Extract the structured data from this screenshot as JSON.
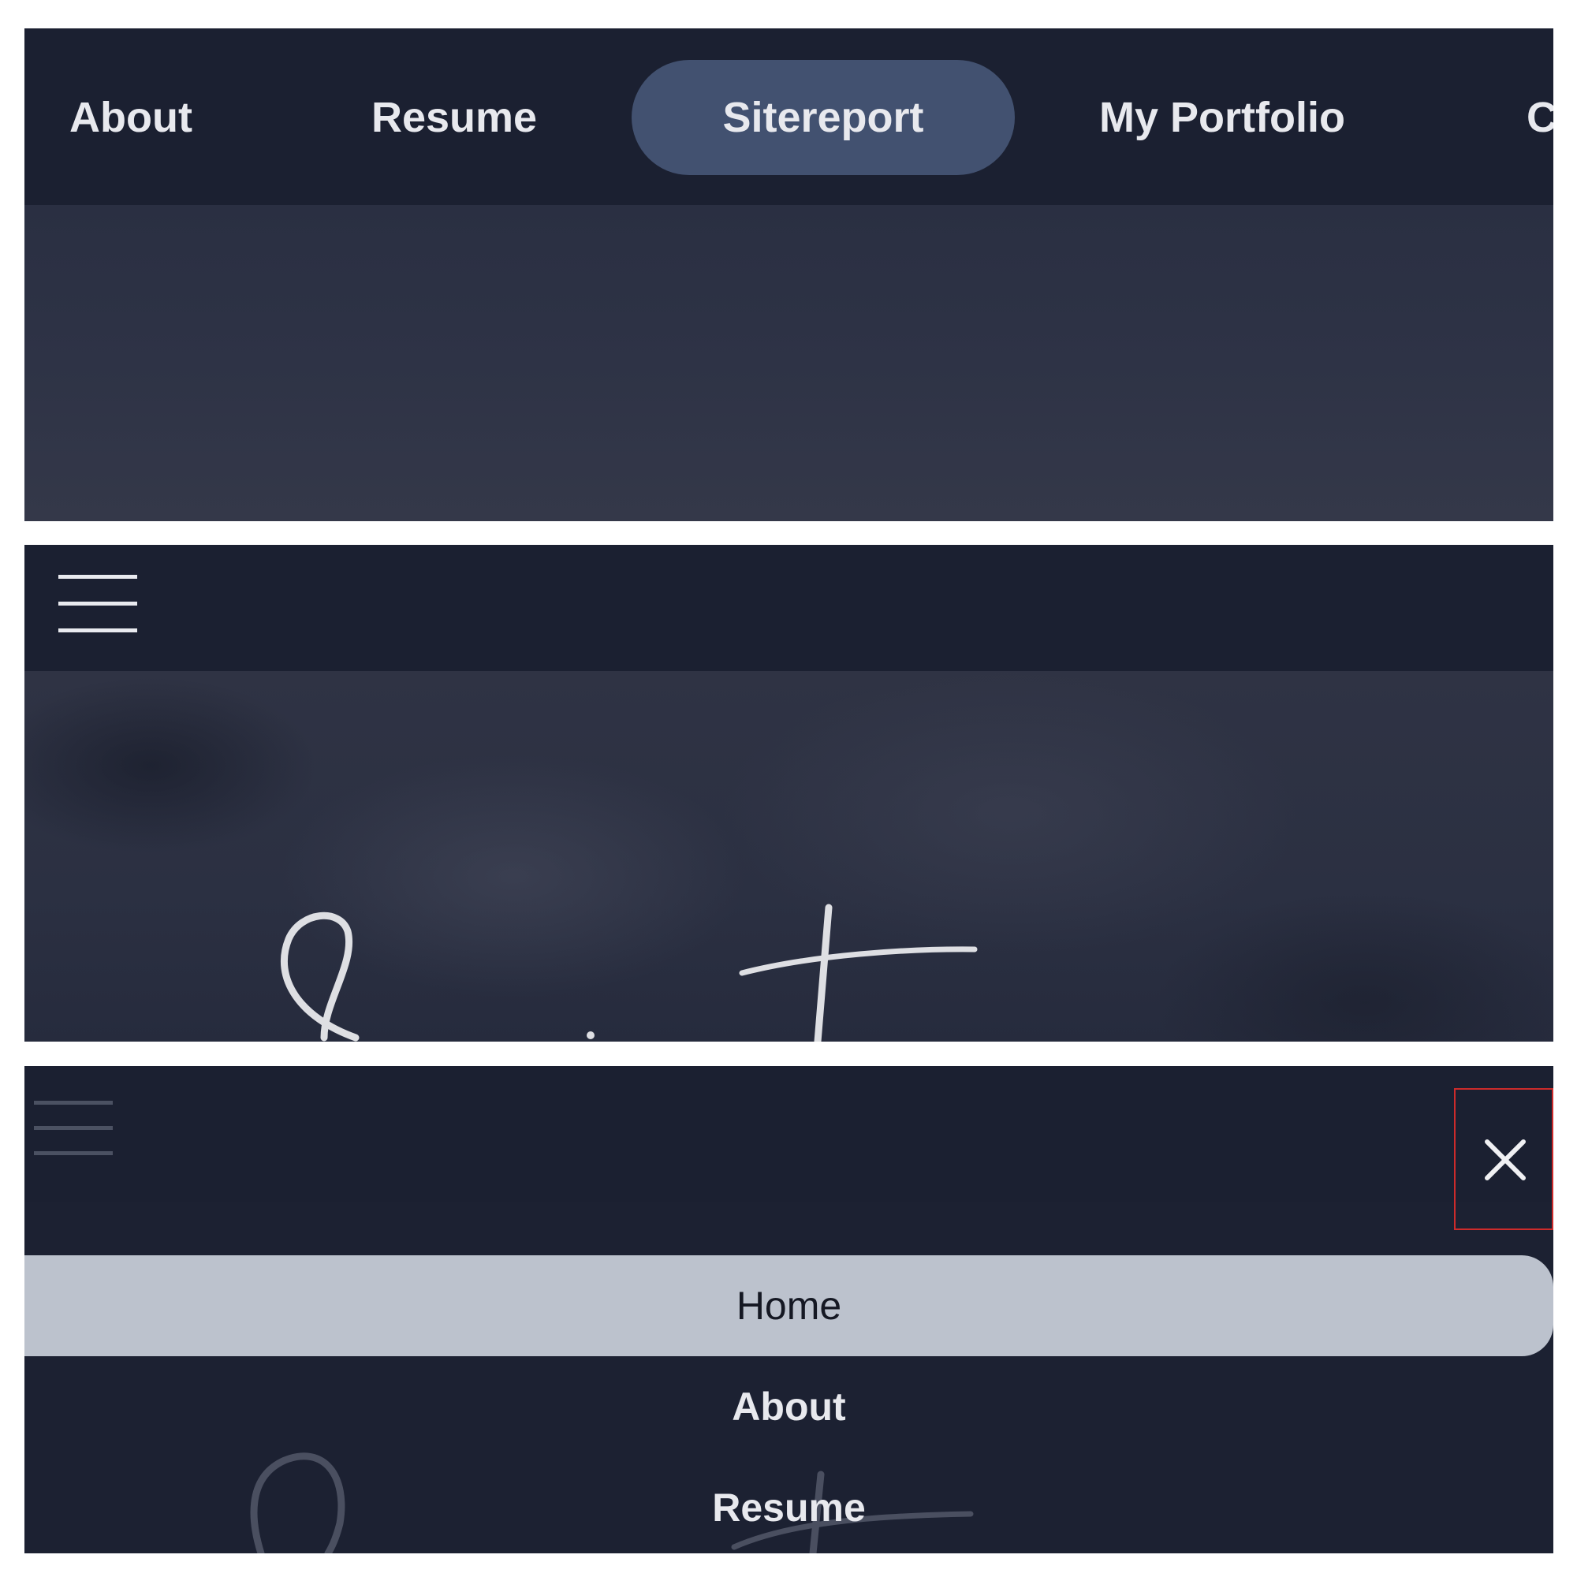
{
  "desktop_nav": {
    "items": [
      {
        "label": "About"
      },
      {
        "label": "Resume"
      },
      {
        "label": "Sitereport",
        "active": true
      },
      {
        "label": "My Portfolio"
      },
      {
        "label": "C"
      }
    ],
    "colors": {
      "bar": "#1b2031",
      "active_pill": "#425170",
      "text": "#e8e9ee"
    }
  },
  "mobile_nav_open": {
    "menu_items": [
      {
        "label": "Home",
        "selected": true
      },
      {
        "label": "About"
      },
      {
        "label": "Resume"
      }
    ],
    "close_icon": "close-icon",
    "colors": {
      "selected_bg": "#bcc2cd",
      "focus_outline": "#cc2b2b"
    }
  },
  "icons": {
    "menu": "hamburger-menu-icon",
    "close": "close-icon"
  }
}
